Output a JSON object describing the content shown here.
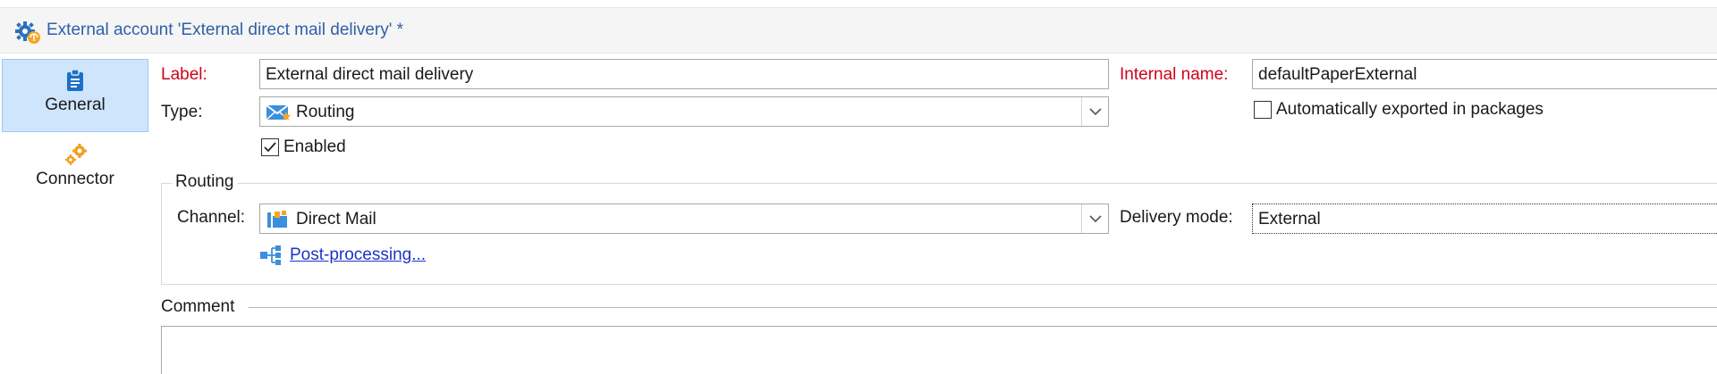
{
  "window": {
    "title": "External account 'External direct mail delivery' *"
  },
  "sidebar": {
    "tabs": [
      {
        "label": "General",
        "icon": "clipboard-icon",
        "active": true
      },
      {
        "label": "Connector",
        "icon": "gears-icon",
        "active": false
      }
    ]
  },
  "form": {
    "label": {
      "caption": "Label:",
      "value": "External direct mail delivery"
    },
    "internal_name": {
      "caption": "Internal name:",
      "value": "defaultPaperExternal"
    },
    "type": {
      "caption": "Type:",
      "value": "Routing",
      "icon": "routing-envelope-icon"
    },
    "auto_export": {
      "label": "Automatically exported in packages",
      "checked": false
    },
    "enabled": {
      "label": "Enabled",
      "checked": true
    },
    "routing": {
      "legend": "Routing",
      "channel": {
        "caption": "Channel:",
        "value": "Direct Mail",
        "icon": "direct-mail-icon"
      },
      "delivery_mode": {
        "caption": "Delivery mode:",
        "value": "External"
      },
      "post_processing": {
        "label": "Post-processing..."
      }
    },
    "comment": {
      "legend": "Comment",
      "value": ""
    }
  },
  "colors": {
    "title_text": "#2f5fa8",
    "required_label": "#d0021b",
    "active_tab_bg": "#cfe5fb",
    "link": "#1a35c8"
  }
}
